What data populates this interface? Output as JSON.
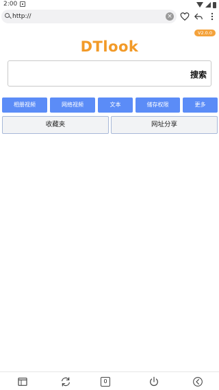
{
  "status_bar": {
    "time": "2:00"
  },
  "url_bar": {
    "value": "http://"
  },
  "version": "V2.0.0",
  "logo": "DTlook",
  "search": {
    "button_label": "搜索"
  },
  "buttons": [
    {
      "label": "相册视频"
    },
    {
      "label": "网络视频"
    },
    {
      "label": "文本"
    },
    {
      "label": "储存权限"
    },
    {
      "label": "更多"
    }
  ],
  "secondary_buttons": [
    {
      "label": "收藏夹"
    },
    {
      "label": "网址分享"
    }
  ],
  "bottom_nav": {
    "tab_count": "0"
  },
  "colors": {
    "accent": "#5b8cf7",
    "logo": "#f29a28",
    "badge": "#f4a23b"
  }
}
